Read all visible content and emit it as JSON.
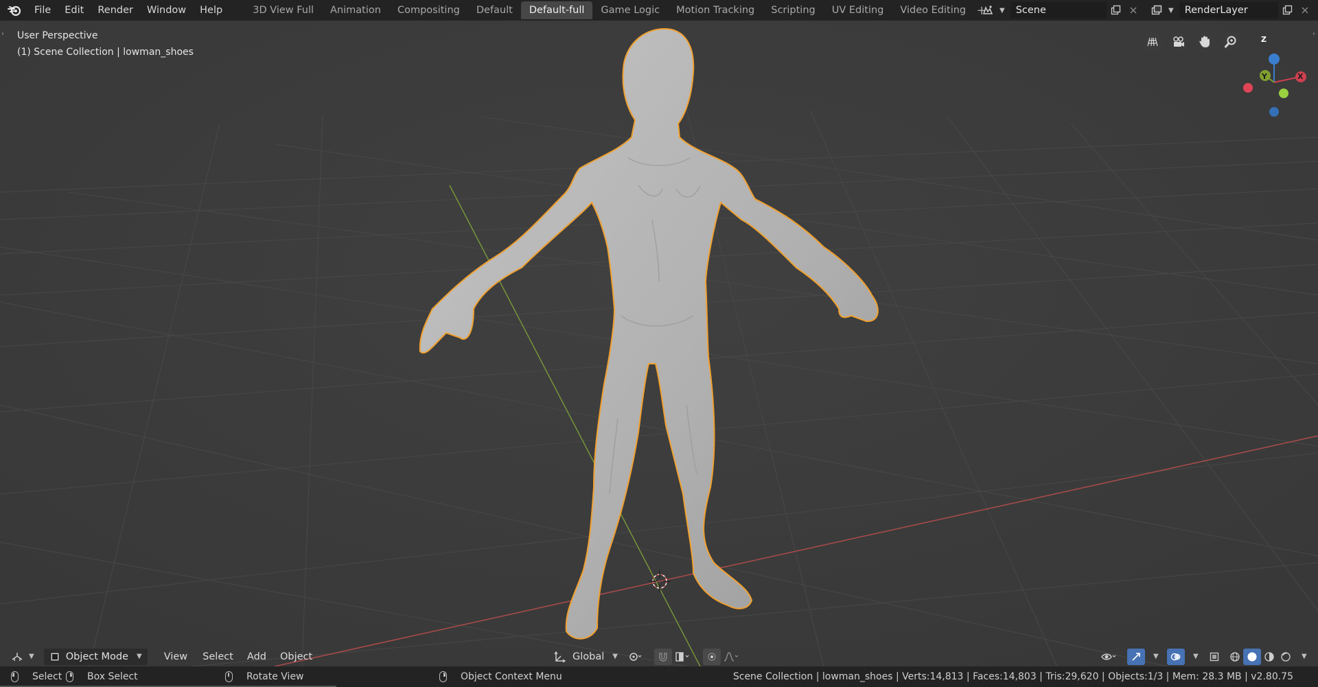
{
  "topbar": {
    "menu": [
      "File",
      "Edit",
      "Render",
      "Window",
      "Help"
    ],
    "workspaces": [
      "3D View Full",
      "Animation",
      "Compositing",
      "Default",
      "Default-full",
      "Game Logic",
      "Motion Tracking",
      "Scripting",
      "UV Editing",
      "Video Editing"
    ],
    "active_workspace": "Default-full",
    "add_tab": "+",
    "scene_name": "Scene",
    "view_layer": "RenderLayer"
  },
  "viewport": {
    "perspective": "User Perspective",
    "collection_info": "(1) Scene Collection | lowman_shoes",
    "gizmo": {
      "z": "Z",
      "y": "Y",
      "x": "X"
    }
  },
  "header": {
    "mode": "Object Mode",
    "menus": [
      "View",
      "Select",
      "Add",
      "Object"
    ],
    "orientation": "Global"
  },
  "status": {
    "select": "Select",
    "box_select": "Box Select",
    "rotate_view": "Rotate View",
    "context_menu": "Object Context Menu",
    "stats": "Scene Collection | lowman_shoes | Verts:14,813 | Faces:14,803 | Tris:29,620 | Objects:1/3 | Mem: 28.3 MB | v2.80.75"
  },
  "colors": {
    "topbar_bg": "#232323",
    "viewport_bg": "#3d3d3d",
    "grid_line": "#474747",
    "x_axis": "#a84a4a",
    "y_axis": "#7a9a3a",
    "selection_outline": "#f0a030",
    "mesh": "#b6b6b6"
  }
}
